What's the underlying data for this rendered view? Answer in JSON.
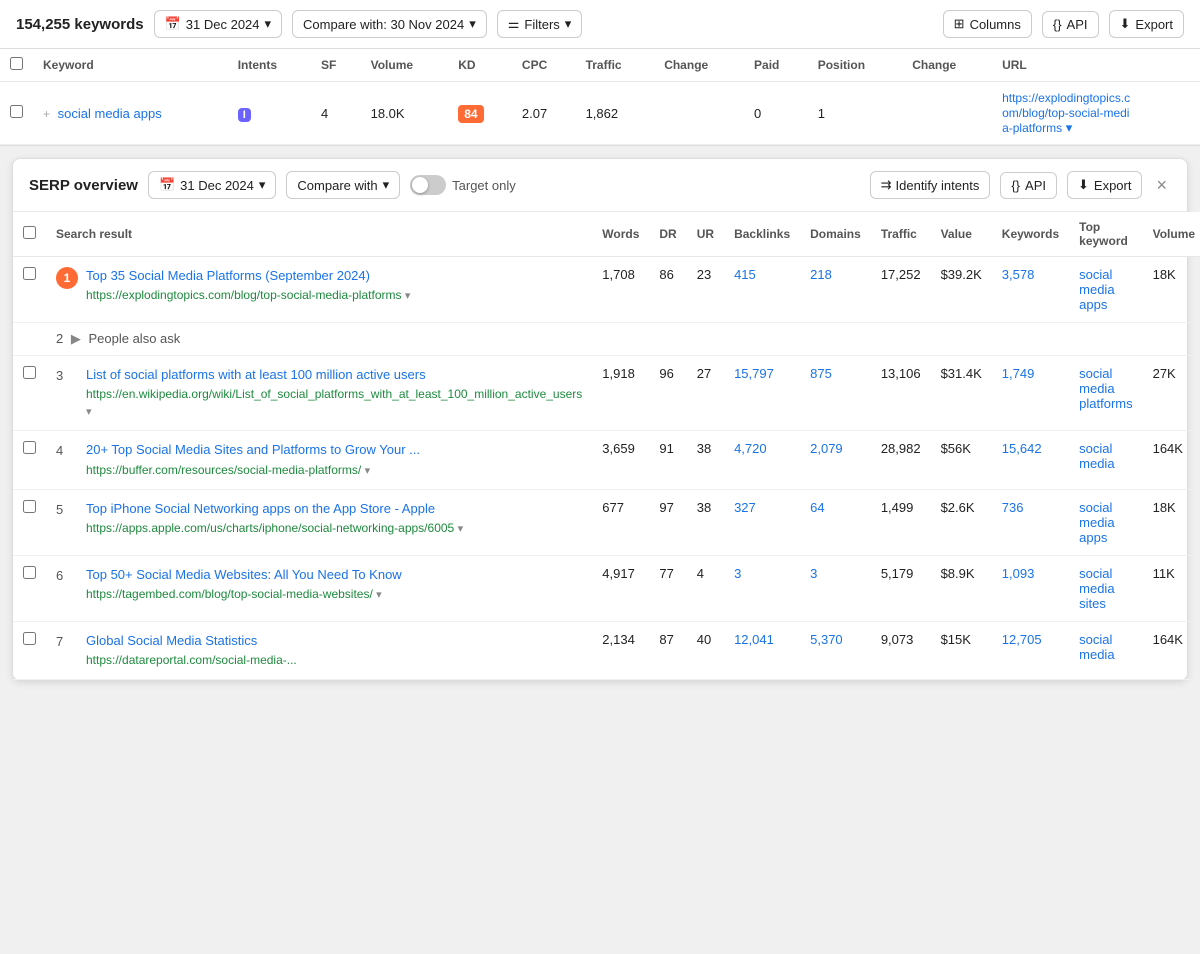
{
  "topBar": {
    "kwCount": "154,255 keywords",
    "dateBtn": "31 Dec 2024",
    "compareBtn": "Compare with: 30 Nov 2024",
    "filtersBtn": "Filters",
    "columnsBtn": "Columns",
    "apiBtn": "API",
    "exportBtn": "Export"
  },
  "kwTable": {
    "columns": [
      "",
      "Keyword",
      "Intents",
      "SF",
      "Volume",
      "KD",
      "CPC",
      "Traffic",
      "Change",
      "Paid",
      "Position",
      "Change",
      "URL"
    ],
    "rows": [
      {
        "keyword": "social media apps",
        "intent": "I",
        "sf": "4",
        "volume": "18.0K",
        "kd": "84",
        "cpc": "2.07",
        "traffic": "1,862",
        "change": "",
        "paid": "0",
        "position": "1",
        "posChange": "",
        "url": "https://explodingtopics.com/blog/top-social-media-platforms"
      }
    ]
  },
  "serpPanel": {
    "title": "SERP overview",
    "date": "31 Dec 2024",
    "compareWith": "Compare with",
    "targetOnly": "Target only",
    "identifyIntents": "Identify intents",
    "apiBtn": "API",
    "exportBtn": "Export",
    "columns": [
      "",
      "Search result",
      "Words",
      "DR",
      "UR",
      "Backlinks",
      "Domains",
      "Traffic",
      "Value",
      "Keywords",
      "Top keyword",
      "Volume"
    ],
    "rows": [
      {
        "rank": "1",
        "rankHighlight": true,
        "title": "Top 35 Social Media Platforms (September 2024)",
        "url": "https://explodingtopics.com/blog/top-social-media-platforms",
        "urlShort": "https://explodingtopics.com/blog/top-\nsocial-media-platforms",
        "words": "1,708",
        "dr": "86",
        "ur": "23",
        "backlinks": "415",
        "domains": "218",
        "traffic": "17,252",
        "value": "$39.2K",
        "keywords": "3,578",
        "topKeyword": "social media apps",
        "volume": "18K",
        "isPAA": false
      },
      {
        "rank": "2",
        "rankHighlight": false,
        "isPAA": true,
        "paaText": "People also ask",
        "title": "",
        "url": "",
        "words": "",
        "dr": "",
        "ur": "",
        "backlinks": "",
        "domains": "",
        "traffic": "",
        "value": "",
        "keywords": "",
        "topKeyword": "",
        "volume": ""
      },
      {
        "rank": "3",
        "rankHighlight": false,
        "isPAA": false,
        "title": "List of social platforms with at least 100 million active users",
        "url": "https://en.wikipedia.org/wiki/List_of_social_platforms_with_at_least_100_million_active_users",
        "words": "1,918",
        "dr": "96",
        "ur": "27",
        "backlinks": "15,797",
        "domains": "875",
        "traffic": "13,106",
        "value": "$31.4K",
        "keywords": "1,749",
        "topKeyword": "social media platforms",
        "volume": "27K"
      },
      {
        "rank": "4",
        "rankHighlight": false,
        "isPAA": false,
        "title": "20+ Top Social Media Sites and Platforms to Grow Your ...",
        "url": "https://buffer.com/resources/social-media-platforms/",
        "words": "3,659",
        "dr": "91",
        "ur": "38",
        "backlinks": "4,720",
        "domains": "2,079",
        "traffic": "28,982",
        "value": "$56K",
        "keywords": "15,642",
        "topKeyword": "social media",
        "volume": "164K"
      },
      {
        "rank": "5",
        "rankHighlight": false,
        "isPAA": false,
        "title": "Top iPhone Social Networking apps on the App Store - Apple",
        "url": "https://apps.apple.com/us/charts/iphone/social-networking-apps/6005",
        "words": "677",
        "dr": "97",
        "ur": "38",
        "backlinks": "327",
        "domains": "64",
        "traffic": "1,499",
        "value": "$2.6K",
        "keywords": "736",
        "topKeyword": "social media apps",
        "volume": "18K"
      },
      {
        "rank": "6",
        "rankHighlight": false,
        "isPAA": false,
        "title": "Top 50+ Social Media Websites: All You Need To Know",
        "url": "https://tagembed.com/blog/top-social-media-websites/",
        "words": "4,917",
        "dr": "77",
        "ur": "4",
        "backlinks": "3",
        "domains": "3",
        "traffic": "5,179",
        "value": "$8.9K",
        "keywords": "1,093",
        "topKeyword": "social media sites",
        "volume": "11K"
      },
      {
        "rank": "7",
        "rankHighlight": false,
        "isPAA": false,
        "title": "Global Social Media Statistics",
        "url": "https://datareportal.com/social-media-...",
        "words": "2,134",
        "dr": "87",
        "ur": "40",
        "backlinks": "12,041",
        "domains": "5,370",
        "traffic": "9,073",
        "value": "$15K",
        "keywords": "12,705",
        "topKeyword": "social media",
        "volume": "164K"
      }
    ]
  }
}
